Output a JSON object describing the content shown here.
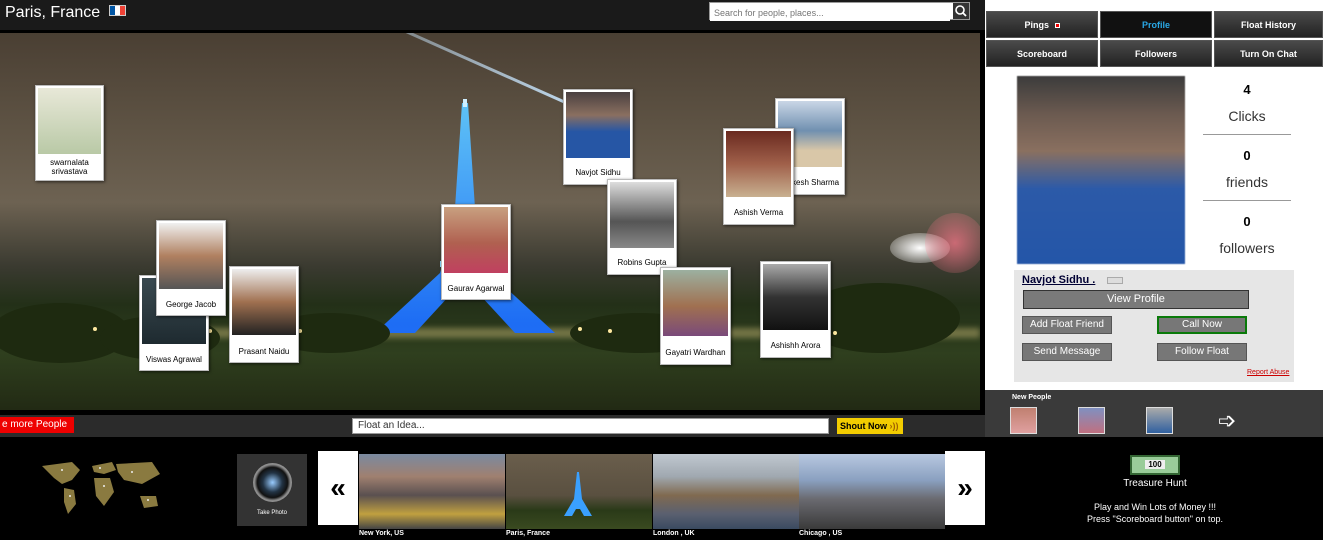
{
  "header": {
    "city": "Paris, France",
    "search_placeholder": "Search for people, places..."
  },
  "scene": {
    "people": [
      {
        "name": "swarnalata srivastava"
      },
      {
        "name": "Navjot Sidhu"
      },
      {
        "name": "Mukesh Sharma"
      },
      {
        "name": "Ashish Verma"
      },
      {
        "name": "Robins Gupta"
      },
      {
        "name": "Gaurav Agarwal"
      },
      {
        "name": "George Jacob"
      },
      {
        "name": "Viswas Agrawal"
      },
      {
        "name": "Prasant Naidu"
      },
      {
        "name": "Gayatri Wardhan"
      },
      {
        "name": "Ashishh Arora"
      }
    ]
  },
  "bottom_bar": {
    "more_people": "e more People",
    "idea_placeholder": "Float an Idea...",
    "shout_label": "Shout Now"
  },
  "tabs": {
    "pings": "Pings",
    "profile": "Profile",
    "float_history": "Float History",
    "scoreboard": "Scoreboard",
    "followers": "Followers",
    "turn_on_chat": "Turn On Chat"
  },
  "profile": {
    "name": "Navjot Sidhu .",
    "stats": [
      {
        "value": "4",
        "label": "Clicks"
      },
      {
        "value": "0",
        "label": "friends"
      },
      {
        "value": "0",
        "label": "followers"
      }
    ],
    "buttons": {
      "view_profile": "View Profile",
      "add_friend": "Add Float Friend",
      "call_now": "Call Now",
      "send_message": "Send Message",
      "follow_float": "Follow Float",
      "report_abuse": "Report Abuse"
    }
  },
  "new_people": {
    "label": "New People"
  },
  "footer": {
    "take_photo": "Take Photo",
    "prev": "«",
    "next": "»",
    "cities": [
      "New York, US",
      "Paris, France",
      "London , UK",
      "Chicago , US"
    ],
    "money_label": "100",
    "treasure_title": "Treasure Hunt",
    "treasure_line1": "Play and Win Lots of Money !!!",
    "treasure_line2": "Press \"Scoreboard button\" on top."
  },
  "colors": {
    "accent_blue": "#29a8e6",
    "more_people_red": "#ee0000",
    "shout_yellow": "#f2cc00",
    "call_green": "#0a7a0a"
  }
}
